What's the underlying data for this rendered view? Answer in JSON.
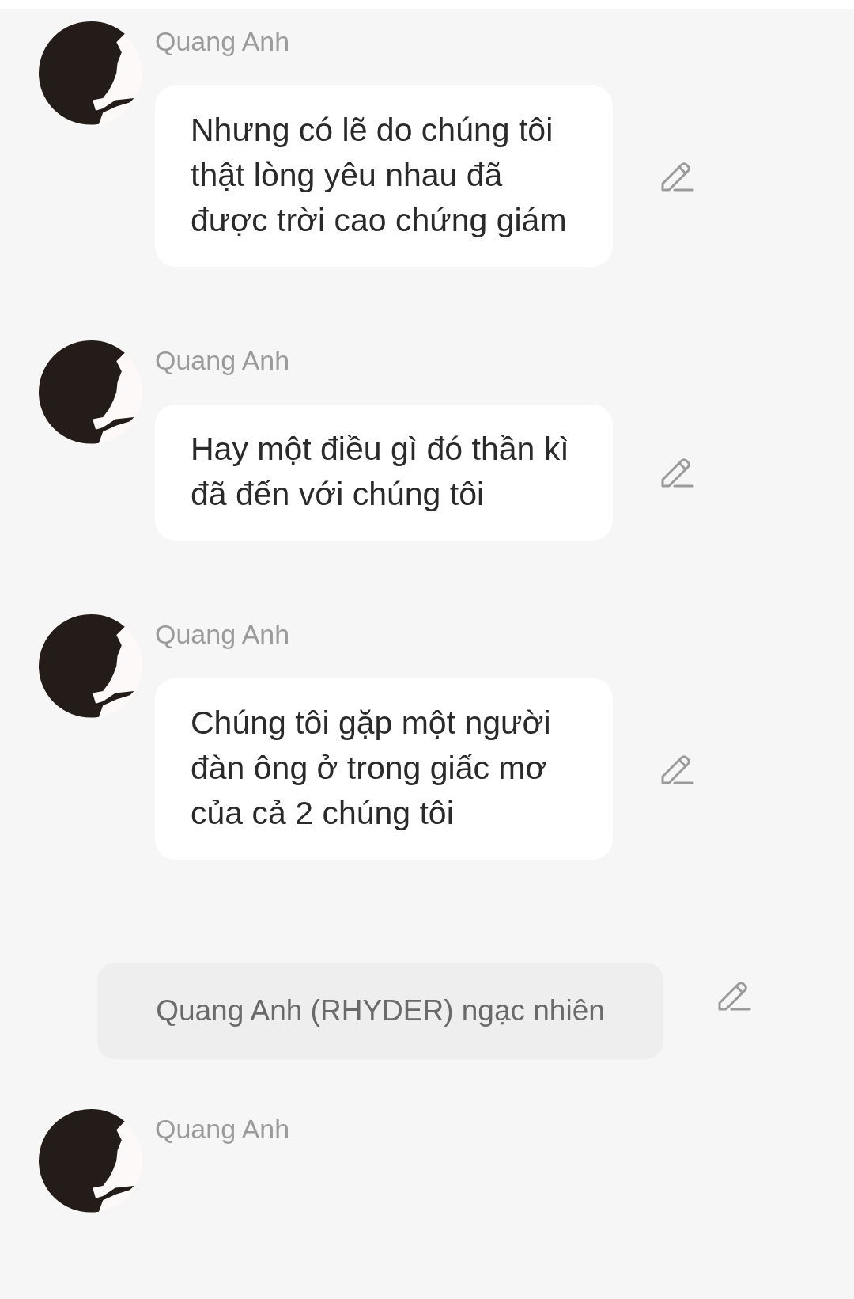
{
  "chat": [
    {
      "kind": "message",
      "sender": "Quang Anh",
      "text": "Nhưng có lẽ do chúng tôi thật lòng yêu nhau đã được trời cao chứng giám"
    },
    {
      "kind": "message",
      "sender": "Quang Anh",
      "text": "Hay một điều gì đó thần kì đã đến với chúng tôi"
    },
    {
      "kind": "message",
      "sender": "Quang Anh",
      "text": "Chúng tôi gặp một người đàn ông ở trong giấc mơ của cả 2 chúng tôi"
    },
    {
      "kind": "narration",
      "text": "Quang Anh (RHYDER) ngạc nhiên"
    },
    {
      "kind": "message",
      "sender": "Quang Anh"
    }
  ]
}
